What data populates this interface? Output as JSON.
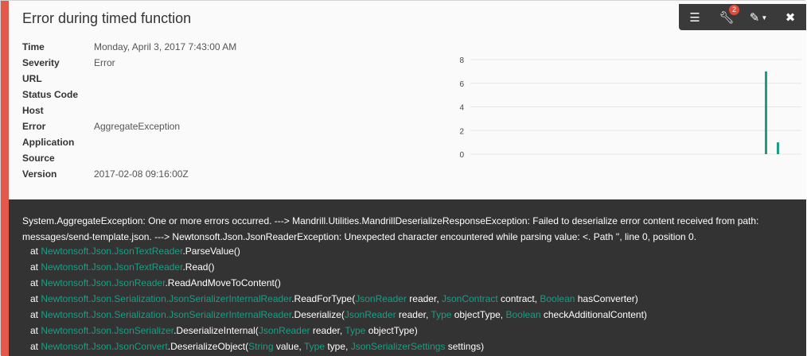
{
  "title": "Error during timed function",
  "toolbar": {
    "badge_count": "2",
    "icons": [
      "menu-icon",
      "wrench-icon",
      "pencil-icon",
      "close-icon"
    ]
  },
  "details": [
    {
      "label": "Time",
      "value": "Monday, April 3, 2017 7:43:00 AM"
    },
    {
      "label": "Severity",
      "value": "Error"
    },
    {
      "label": "URL",
      "value": ""
    },
    {
      "label": "Status Code",
      "value": ""
    },
    {
      "label": "Host",
      "value": ""
    },
    {
      "label": "Error",
      "value": "AggregateException"
    },
    {
      "label": "Application",
      "value": ""
    },
    {
      "label": "Source",
      "value": ""
    },
    {
      "label": "Version",
      "value": "2017-02-08 09:16:00Z"
    }
  ],
  "chart_data": {
    "type": "bar",
    "yticks": [
      "8",
      "6",
      "4",
      "2",
      "0"
    ],
    "ylim": [
      0,
      8
    ],
    "series": [
      {
        "values": [
          7,
          1
        ]
      }
    ],
    "grid": true
  },
  "stack": {
    "message": "System.AggregateException: One or more errors occurred. ---> Mandrill.Utilities.MandrillDeserializeResponseException: Failed to deserialize error content received from path: messages/send-template.json. ---> Newtonsoft.Json.JsonReaderException: Unexpected character encountered while parsing value: <. Path '', line 0, position 0.",
    "frames": [
      {
        "at": "at",
        "type": "Newtonsoft.Json.JsonTextReader",
        "method": ".ParseValue()"
      },
      {
        "at": "at",
        "type": "Newtonsoft.Json.JsonTextReader",
        "method": ".Read()"
      },
      {
        "at": "at",
        "type": "Newtonsoft.Json.JsonReader",
        "method": ".ReadAndMoveToContent()"
      },
      {
        "at": "at",
        "type": "Newtonsoft.Json.Serialization.JsonSerializerInternalReader",
        "method": ".ReadForType(",
        "params": [
          {
            "t": "JsonReader",
            "n": " reader, "
          },
          {
            "t": "JsonContract",
            "n": " contract, "
          },
          {
            "t": "Boolean",
            "n": " hasConverter)"
          }
        ]
      },
      {
        "at": "at",
        "type": "Newtonsoft.Json.Serialization.JsonSerializerInternalReader",
        "method": ".Deserialize(",
        "params": [
          {
            "t": "JsonReader",
            "n": " reader, "
          },
          {
            "t": "Type",
            "n": " objectType, "
          },
          {
            "t": "Boolean",
            "n": " checkAdditionalContent)"
          }
        ]
      },
      {
        "at": "at",
        "type": "Newtonsoft.Json.JsonSerializer",
        "method": ".DeserializeInternal(",
        "params": [
          {
            "t": "JsonReader",
            "n": " reader, "
          },
          {
            "t": "Type",
            "n": " objectType)"
          }
        ]
      },
      {
        "at": "at",
        "type": "Newtonsoft.Json.JsonConvert",
        "method": ".DeserializeObject(",
        "params": [
          {
            "t": "String",
            "n": " value, "
          },
          {
            "t": "Type",
            "n": " type, "
          },
          {
            "t": "JsonSerializerSettings",
            "n": " settings)"
          }
        ]
      }
    ]
  },
  "colors": {
    "accent": "#e4574b",
    "type_highlight": "#1a9e85",
    "stack_bg": "#333333",
    "bar": "#1a9e85"
  }
}
